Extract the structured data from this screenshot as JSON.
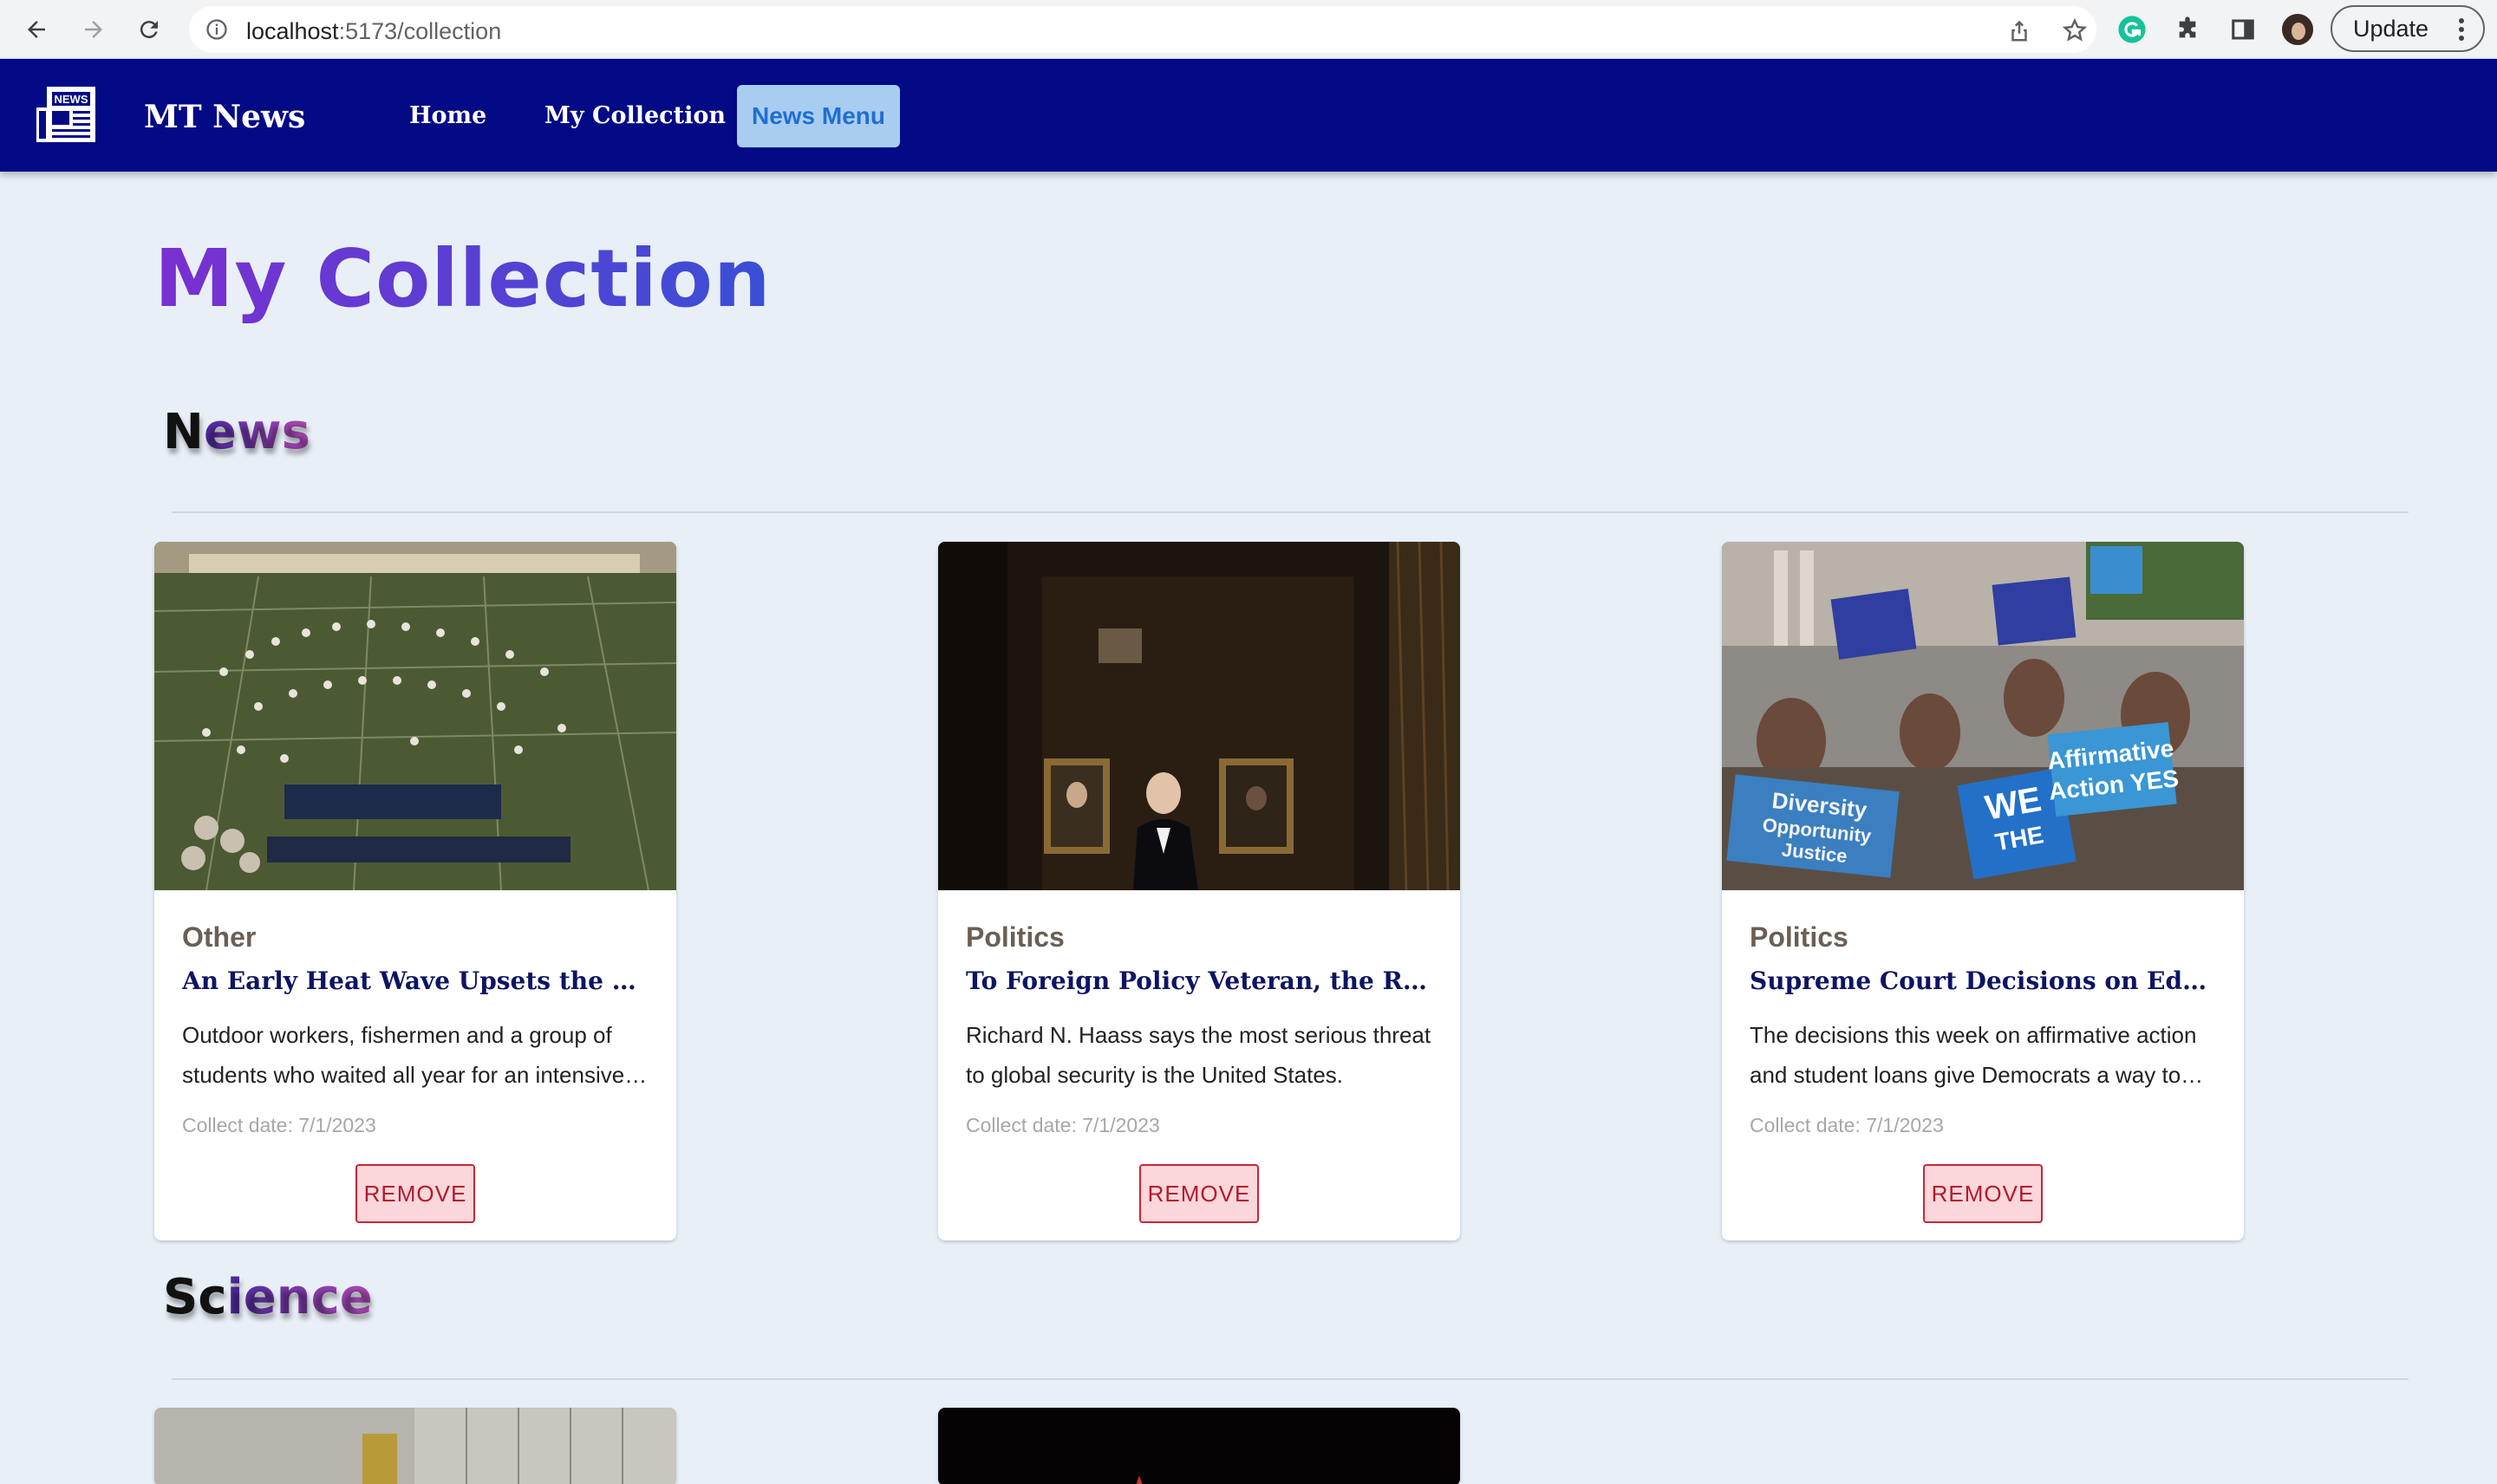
{
  "browser": {
    "url_host": "localhost",
    "url_path": ":5173/collection",
    "update_label": "Update"
  },
  "header": {
    "brand": "MT News",
    "logo_text": "NEWS",
    "nav": [
      {
        "label": "Home"
      },
      {
        "label": "My Collection"
      },
      {
        "label": "News Menu",
        "active": true
      }
    ]
  },
  "page": {
    "title": "My Collection"
  },
  "sections": [
    {
      "title_first": "N",
      "title_rest": "ews",
      "cards": [
        {
          "category": "Other",
          "title": "An Early Heat Wave Upsets the Rhythms of Life in Texas",
          "description": "Outdoor workers, fishermen and a group of students who waited all year for an intensive summer of marching band practice",
          "collect_date": "Collect date: 7/1/2023",
          "remove_label": "REMOVE",
          "image": "marching-band-field-photo"
        },
        {
          "category": "Politics",
          "title": "To Foreign Policy Veteran, the Real Threat Is Within",
          "description": "Richard N. Haass says the most serious threat to global security is the United States.",
          "collect_date": "Collect date: 7/1/2023",
          "remove_label": "REMOVE",
          "image": "man-portrait-gallery-photo"
        },
        {
          "category": "Politics",
          "title": "Supreme Court Decisions on Education Give Democrats an Opening",
          "description": "The decisions this week on affirmative action and student loans give Democrats a way to energize voters",
          "collect_date": "Collect date: 7/1/2023",
          "remove_label": "REMOVE",
          "image": "protest-signs-photo",
          "signs": [
            "Diversity Opportunity Justice",
            "WE THE PEOPLE",
            "Affirmative Action YES",
            "Diversity"
          ]
        }
      ]
    },
    {
      "title_first": "Sc",
      "title_rest": "ience",
      "cards": [
        {
          "image": "laboratory-photo"
        },
        {
          "image": "dark-night-photo"
        }
      ]
    }
  ],
  "colors": {
    "appbar": "#020a85",
    "page_bg": "#e9eff7",
    "active_menu_bg": "#a9cdf0",
    "remove_border": "#c62835"
  }
}
